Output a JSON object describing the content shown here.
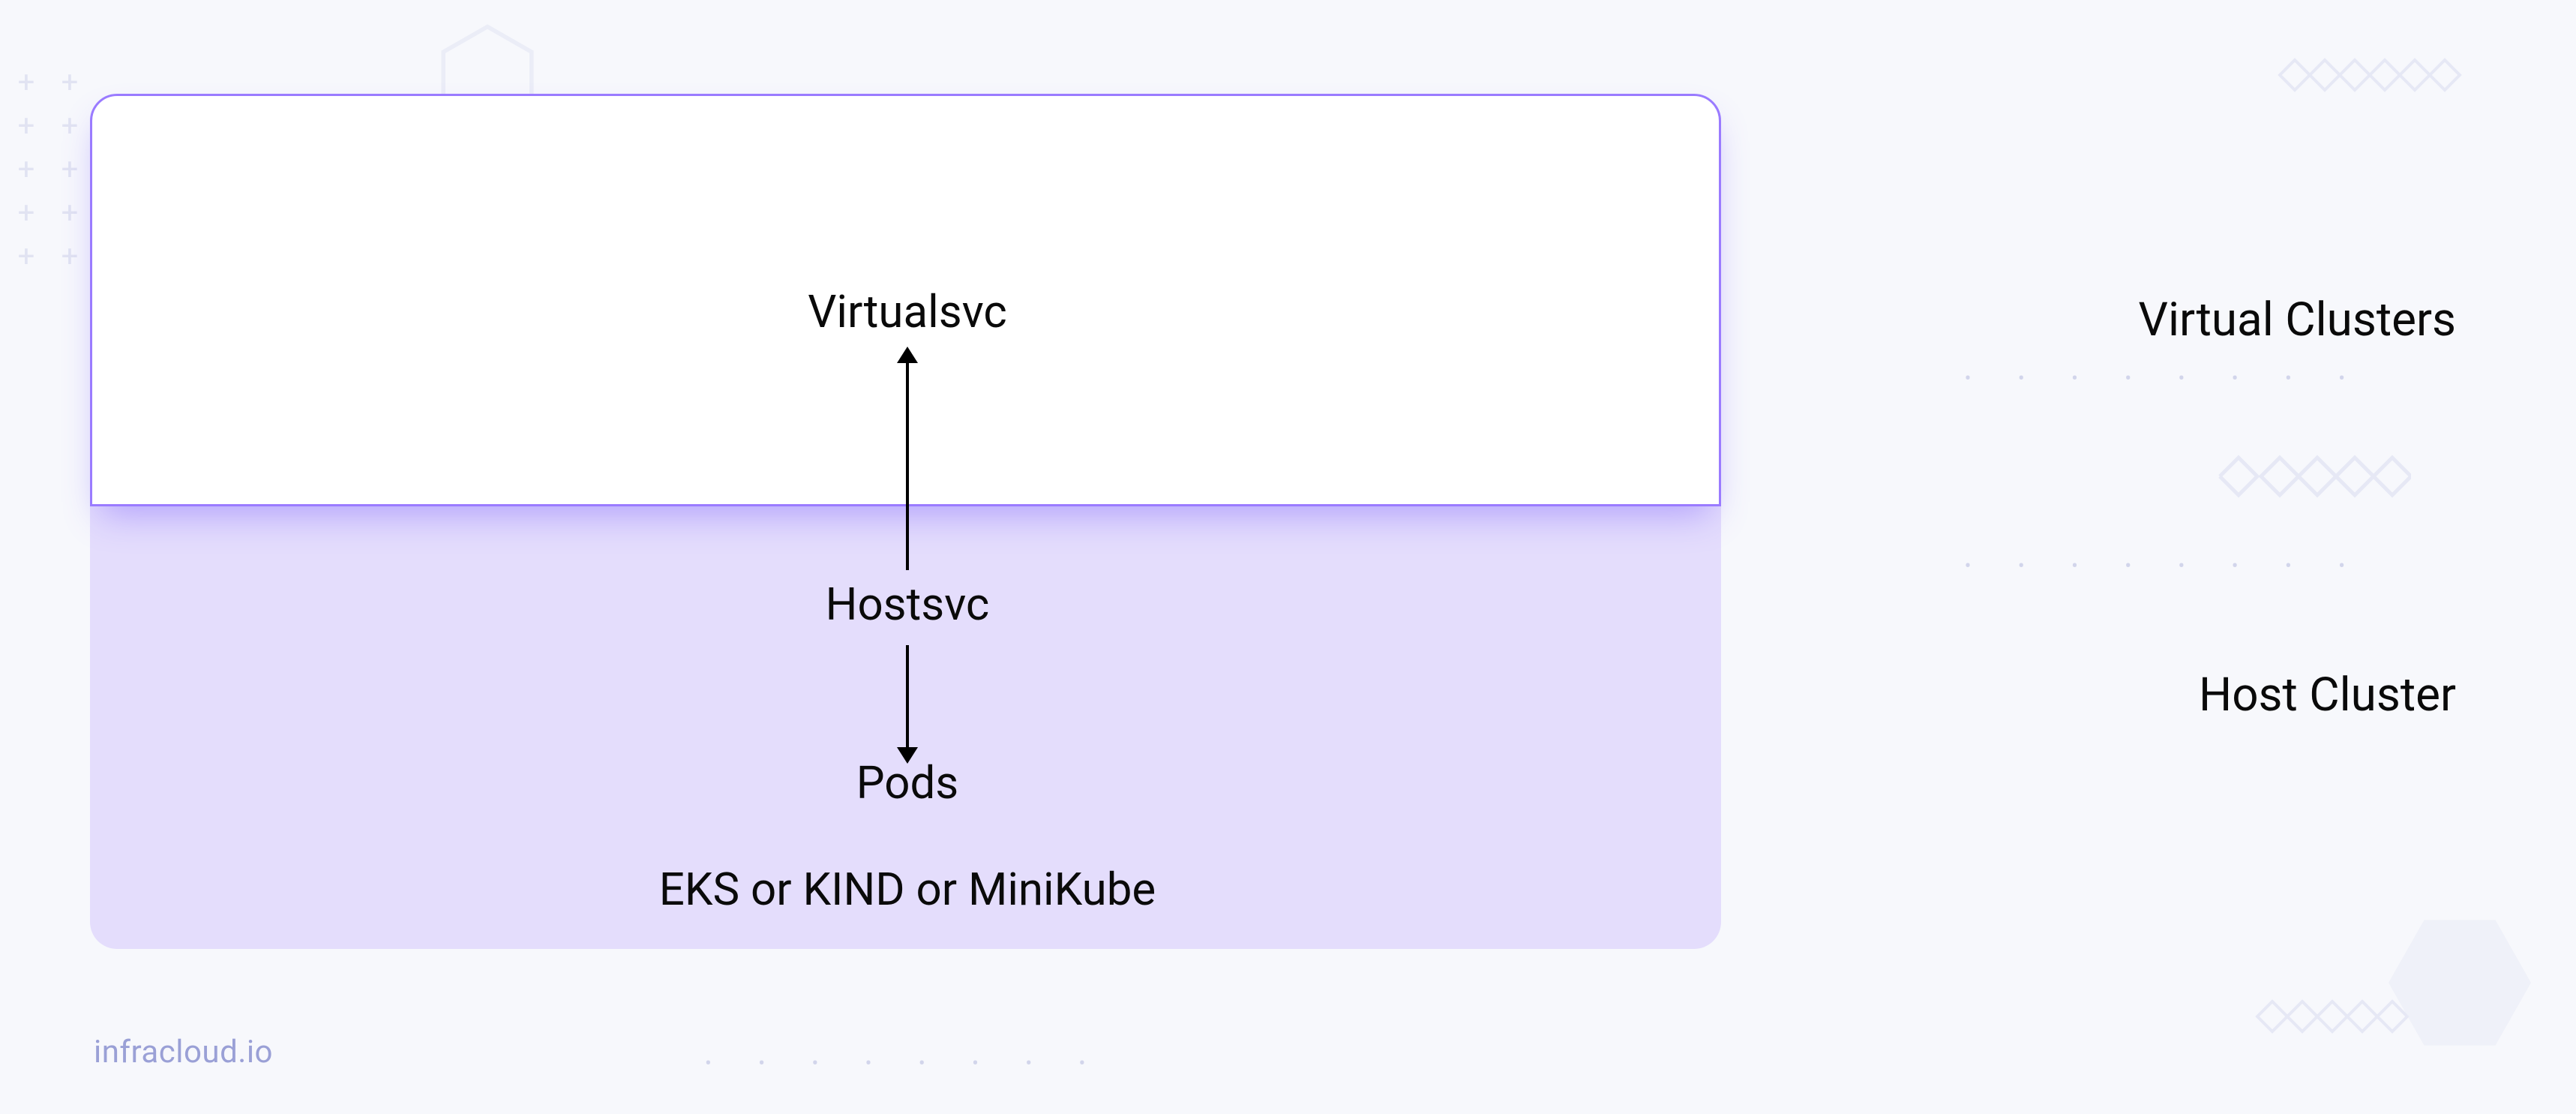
{
  "diagram": {
    "virtual_box": {
      "label": "Virtualsvc"
    },
    "host_box": {
      "service_label": "Hostsvc",
      "pods_label": "Pods",
      "platform_label": "EKS or KIND or MiniKube"
    },
    "side_labels": {
      "virtual": "Virtual Clusters",
      "host": "Host Cluster"
    }
  },
  "footer": {
    "brand": "infracloud.io"
  }
}
